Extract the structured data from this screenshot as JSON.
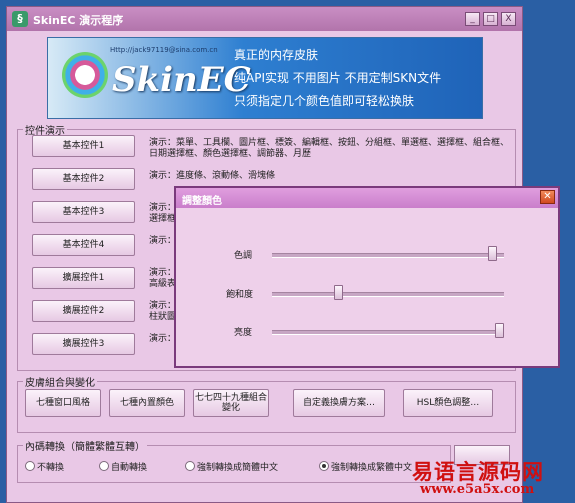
{
  "window": {
    "title": "SkinEC 演示程序",
    "minimize": "_",
    "maximize": "□",
    "close": "X"
  },
  "banner": {
    "email": "Http://jack97119@sina.com.cn",
    "brand": "SkinEC",
    "lines": [
      "真正的内存皮肤",
      "纯API实现 不用图片 不用定制SKN文件",
      "只须指定几个颜色值即可轻松换肤"
    ]
  },
  "controls_group": {
    "legend": "控件演示",
    "buttons": [
      "基本控件1",
      "基本控件2",
      "基本控件3",
      "基本控件4",
      "擴展控件1",
      "擴展控件2",
      "擴展控件3"
    ],
    "descriptions": [
      "演示：菜單、工具欄、圖片框、標簽、編輯框、按鈕、分組框、單選框、選擇框、組合框、日期選擇框、顏色選擇框、調節器、月歷",
      "演示：進度條、滾動條、滑塊條",
      "演示：",
      "演示：",
      "演示：",
      "演示：",
      "演示："
    ],
    "extra_lines": [
      "選擇框",
      "高級表",
      "柱狀圖"
    ]
  },
  "skin_group": {
    "legend": "皮膚組合與變化",
    "buttons": [
      "七種窗口風格",
      "七種內置顏色",
      "七七四十九種組合變化",
      "自定義換膚方案…",
      "HSL顏色調整…"
    ]
  },
  "encoding_group": {
    "legend": "內碼轉換（簡體繁體互轉）",
    "options": [
      "不轉換",
      "自動轉換",
      "強制轉換成簡體中文",
      "強制轉換成繁體中文"
    ],
    "selected_index": 3
  },
  "dialog": {
    "title": "調整顏色",
    "close": "✕",
    "sliders": [
      {
        "label": "色調",
        "value": 0.97
      },
      {
        "label": "飽和度",
        "value": 0.28
      },
      {
        "label": "亮度",
        "value": 1.0
      }
    ]
  },
  "watermark": {
    "text": "易语言源码网",
    "url": "www.e5a5x.com"
  }
}
